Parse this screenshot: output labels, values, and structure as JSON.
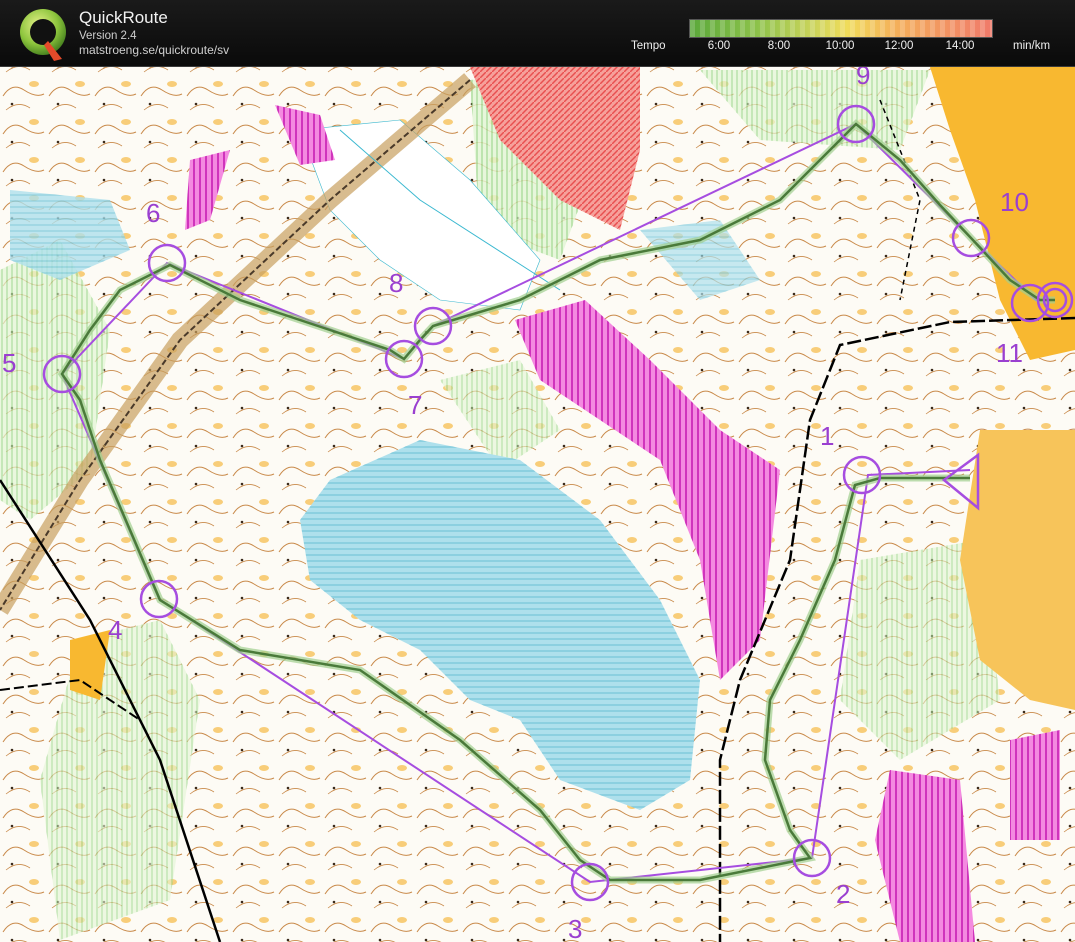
{
  "header": {
    "app_name": "QuickRoute",
    "version": "Version 2.4",
    "url": "matstroeng.se/quickroute/sv",
    "logo_letter": "Q",
    "legend": {
      "label": "Tempo",
      "unit": "min/km",
      "ticks": [
        "6:00",
        "8:00",
        "10:00",
        "12:00",
        "14:00"
      ]
    }
  },
  "controls": [
    {
      "label": "1"
    },
    {
      "label": "2"
    },
    {
      "label": "3"
    },
    {
      "label": "4"
    },
    {
      "label": "5"
    },
    {
      "label": "6"
    },
    {
      "label": "7"
    },
    {
      "label": "8"
    },
    {
      "label": "9"
    },
    {
      "label": "10"
    },
    {
      "label": "11"
    }
  ],
  "colors": {
    "course": "#a64de0",
    "route": "#4a7a3a",
    "route_glow": "#9fcf8f",
    "header_bg": "#111111",
    "water": "#9fd8e8",
    "forest_green": "#c8eab0",
    "orange_area": "#f7c04a",
    "magenta_area": "#e040c8",
    "red_area": "#f07070"
  }
}
